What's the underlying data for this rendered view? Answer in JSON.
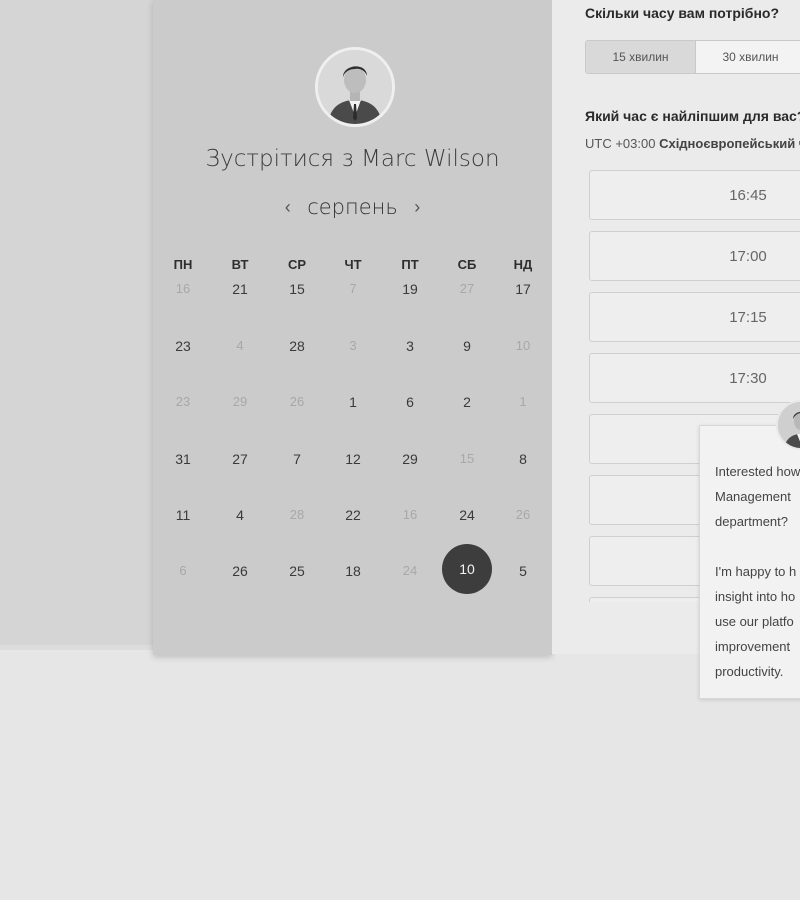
{
  "calendar": {
    "host_prefix": "Зустрітися з",
    "host_name": "Marc Wilson",
    "month": "серпень",
    "prev_icon": "‹",
    "next_icon": "›",
    "weekdays": [
      "ПН",
      "ВТ",
      "СР",
      "ЧТ",
      "ПТ",
      "СБ",
      "НД"
    ],
    "weeks": [
      [
        {
          "d": "16",
          "m": true
        },
        {
          "d": "21"
        },
        {
          "d": "15"
        },
        {
          "d": "7",
          "m": true
        },
        {
          "d": "19"
        },
        {
          "d": "27",
          "m": true
        },
        {
          "d": "17"
        }
      ],
      [
        {
          "d": "23"
        },
        {
          "d": "4",
          "m": true
        },
        {
          "d": "28"
        },
        {
          "d": "3",
          "m": true
        },
        {
          "d": "3"
        },
        {
          "d": "9"
        },
        {
          "d": "10",
          "m": true
        }
      ],
      [
        {
          "d": "23",
          "m": true
        },
        {
          "d": "29",
          "m": true
        },
        {
          "d": "26",
          "m": true
        },
        {
          "d": "1"
        },
        {
          "d": "6"
        },
        {
          "d": "2"
        },
        {
          "d": "1",
          "m": true
        }
      ],
      [
        {
          "d": "31"
        },
        {
          "d": "27"
        },
        {
          "d": "7"
        },
        {
          "d": "12"
        },
        {
          "d": "29"
        },
        {
          "d": "15",
          "m": true
        },
        {
          "d": "8"
        }
      ],
      [
        {
          "d": "11"
        },
        {
          "d": "4"
        },
        {
          "d": "28",
          "m": true
        },
        {
          "d": "22"
        },
        {
          "d": "16",
          "m": true
        },
        {
          "d": "24"
        },
        {
          "d": "26",
          "m": true
        }
      ],
      [
        {
          "d": "6",
          "m": true
        },
        {
          "d": "26"
        },
        {
          "d": "25"
        },
        {
          "d": "18"
        },
        {
          "d": "24",
          "m": true
        },
        {
          "d": "10",
          "sel": true
        },
        {
          "d": "5"
        }
      ]
    ]
  },
  "booking": {
    "duration_question": "Скільки часу вам потрібно?",
    "durations": [
      "15 хвилин",
      "30 хвилин"
    ],
    "active_duration": "15 хвилин",
    "time_question": "Який час є найліпшим для вас?",
    "tz_offset": "UTC +03:00",
    "tz_name": "Східноєвропейський час",
    "slots": [
      "16:45",
      "17:00",
      "17:15",
      "17:30",
      "",
      "",
      "",
      ""
    ]
  },
  "chat": {
    "lines": [
      "Interested how",
      "Management",
      "department?",
      "",
      "I'm happy to h",
      "insight into ho",
      "use our platfo",
      "improvement",
      "productivity."
    ]
  }
}
